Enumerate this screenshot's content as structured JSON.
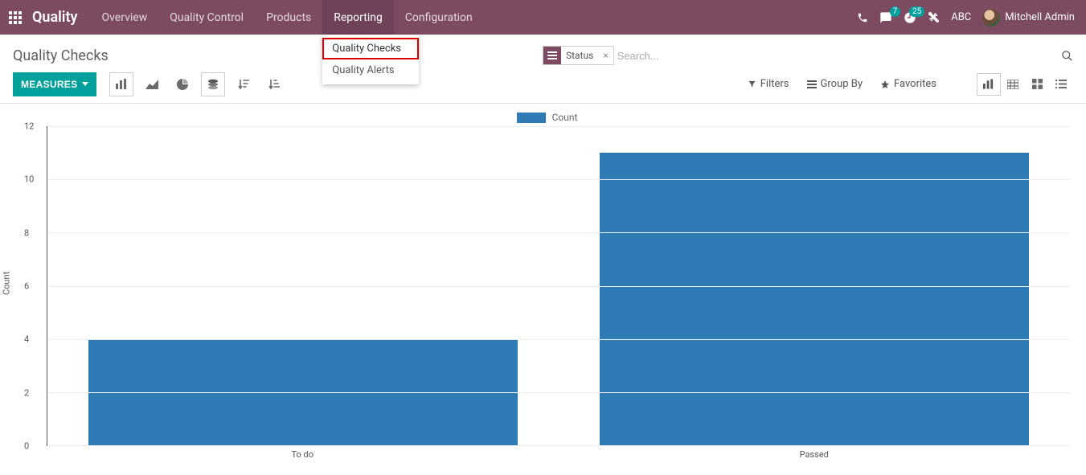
{
  "header": {
    "brand": "Quality",
    "nav": [
      "Overview",
      "Quality Control",
      "Products",
      "Reporting",
      "Configuration"
    ],
    "active_nav": "Reporting",
    "dropdown_items": [
      "Quality Checks",
      "Quality Alerts"
    ],
    "dropdown_highlighted": "Quality Checks",
    "badges": {
      "messages": "7",
      "activities": "25"
    },
    "company": "ABC",
    "user": "Mitchell Admin"
  },
  "control": {
    "title": "Quality Checks",
    "facet_label": "Status",
    "search_placeholder": "Search..."
  },
  "toolbar": {
    "measures": "MEASURES",
    "filters": "Filters",
    "groupby": "Group By",
    "favorites": "Favorites"
  },
  "chart_data": {
    "type": "bar",
    "legend_label": "Count",
    "yaxis_label": "Count",
    "categories": [
      "To do",
      "Passed"
    ],
    "values": [
      4,
      11
    ],
    "ylim": [
      0,
      12
    ],
    "yticks": [
      0,
      2,
      4,
      6,
      8,
      10,
      12
    ],
    "color": "#2f7bb5"
  }
}
